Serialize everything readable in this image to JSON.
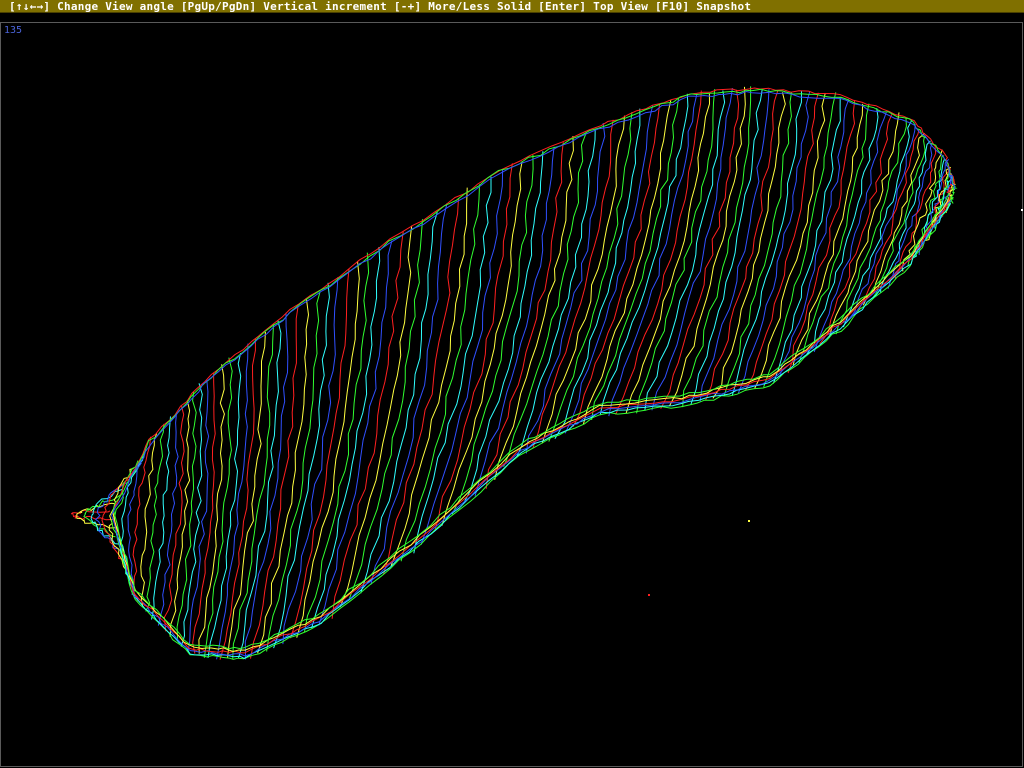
{
  "help_bar": {
    "text": "[↑↓←→] Change View angle [PgUp/PgDn] Vertical increment [-+] More/Less Solid [Enter] Top View [F10] Snapshot"
  },
  "view": {
    "angle": "135"
  },
  "colors": {
    "help_bar_bg": "#807000",
    "help_bar_text": "#ffffff",
    "angle_text": "#4a63d8",
    "background": "#000000",
    "scan_palette": [
      "#ff2020",
      "#ffff40",
      "#30ff30",
      "#30ffff",
      "#3050ff"
    ]
  },
  "scan": {
    "object": "foot insole wireframe scan"
  }
}
